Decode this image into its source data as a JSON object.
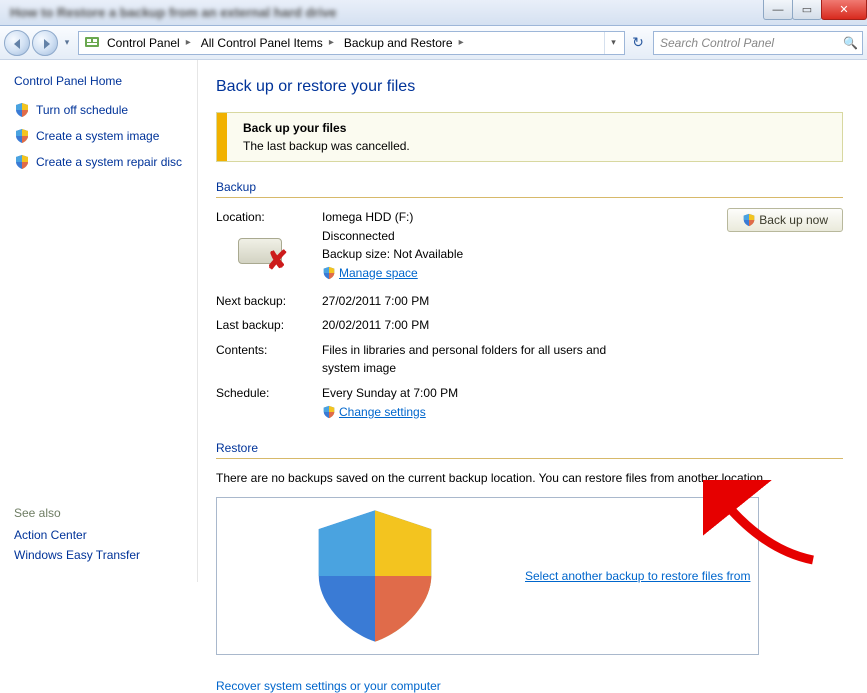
{
  "window": {
    "title_blurred": "How to Restore a backup from an external hard drive"
  },
  "breadcrumb": {
    "items": [
      "Control Panel",
      "All Control Panel Items",
      "Backup and Restore"
    ]
  },
  "search": {
    "placeholder": "Search Control Panel"
  },
  "sidebar": {
    "home": "Control Panel Home",
    "links": [
      "Turn off schedule",
      "Create a system image",
      "Create a system repair disc"
    ],
    "see_also_heading": "See also",
    "see_also": [
      "Action Center",
      "Windows Easy Transfer"
    ]
  },
  "main": {
    "title": "Back up or restore your files",
    "notice_heading": "Back up your files",
    "notice_text": "The last backup was cancelled.",
    "backup": {
      "heading": "Backup",
      "location_label": "Location:",
      "location_name": "Iomega HDD (F:)",
      "location_status": "Disconnected",
      "size_label": "Backup size: Not Available",
      "manage_space": "Manage space",
      "backup_now": "Back up now",
      "next_label": "Next backup:",
      "next_value": "27/02/2011 7:00 PM",
      "last_label": "Last backup:",
      "last_value": "20/02/2011 7:00 PM",
      "contents_label": "Contents:",
      "contents_value": "Files in libraries and personal folders for all users and system image",
      "schedule_label": "Schedule:",
      "schedule_value": "Every Sunday at 7:00 PM",
      "change_settings": "Change settings"
    },
    "restore": {
      "heading": "Restore",
      "text": "There are no backups saved on the current backup location. You can restore files from another location.",
      "select_link": "Select another backup to restore files from",
      "recover_link": "Recover system settings or your computer"
    }
  }
}
